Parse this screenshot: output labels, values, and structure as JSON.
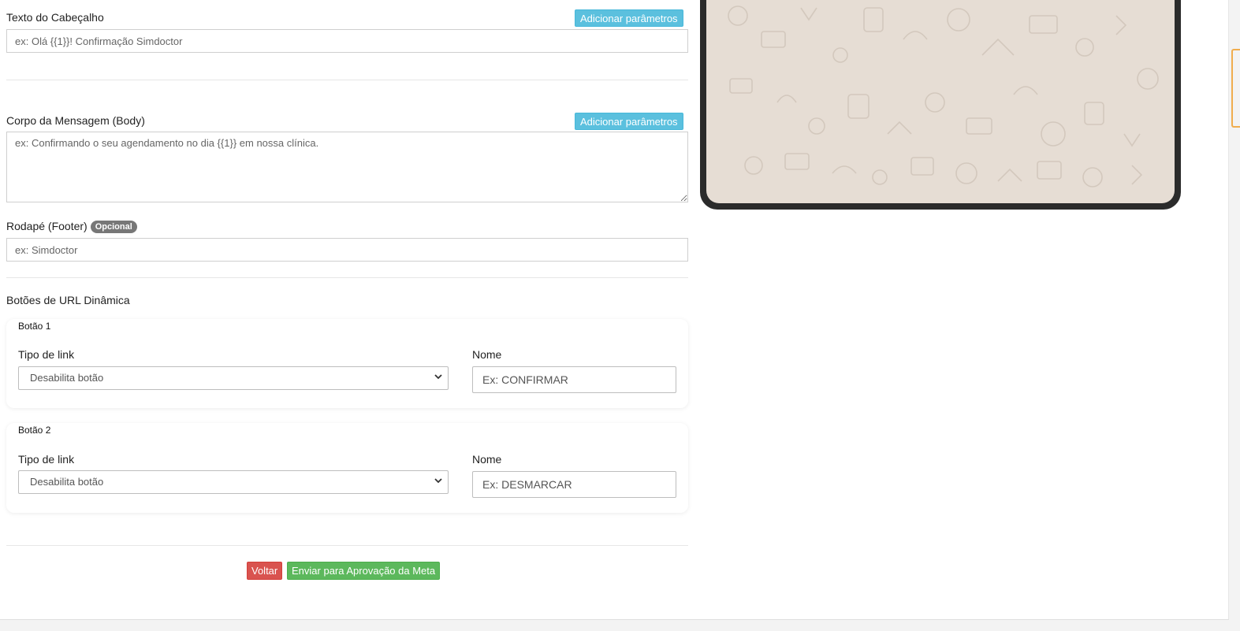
{
  "header_text": {
    "label": "Texto do Cabeçalho",
    "add_params_label": "Adicionar parâmetros",
    "placeholder": "ex: Olá {{1}}! Confirmação Simdoctor"
  },
  "body_text": {
    "label": "Corpo da Mensagem (Body)",
    "add_params_label": "Adicionar parâmetros",
    "placeholder": "ex: Confirmando o seu agendamento no dia {{1}} em nossa clínica."
  },
  "footer_text": {
    "label": "Rodapé (Footer)",
    "badge": "Opcional",
    "placeholder": "ex: Simdoctor"
  },
  "dynamic_buttons": {
    "section_title": "Botões de URL Dinâmica",
    "buttons": [
      {
        "title": "Botão 1",
        "link_type_label": "Tipo de link",
        "link_type_value": "Desabilita botão",
        "name_label": "Nome",
        "name_placeholder": "Ex: CONFIRMAR"
      },
      {
        "title": "Botão 2",
        "link_type_label": "Tipo de link",
        "link_type_value": "Desabilita botão",
        "name_label": "Nome",
        "name_placeholder": "Ex: DESMARCAR"
      }
    ]
  },
  "actions": {
    "back_label": "Voltar",
    "submit_label": "Enviar para Aprovação da Meta"
  },
  "colors": {
    "info": "#5bc0de",
    "danger": "#d9534f",
    "success": "#5cb85c",
    "phone_frame": "#2b2b2b",
    "chat_bg": "#e6ddd4"
  }
}
